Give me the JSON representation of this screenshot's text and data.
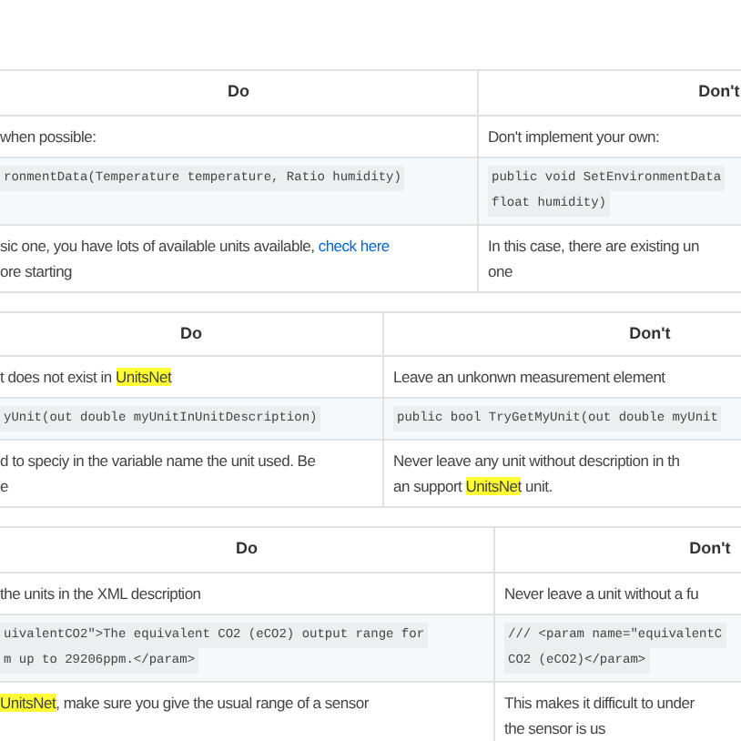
{
  "tables": [
    {
      "header": [
        "Do",
        "Don't"
      ],
      "rows": [
        {
          "cells": [
            {
              "kind": "text",
              "lines": [
                [
                  {
                    "text": "when possible:",
                    "kind": "plain"
                  }
                ]
              ]
            },
            {
              "kind": "text",
              "lines": [
                [
                  {
                    "text": "Don't implement your own:",
                    "kind": "plain"
                  }
                ]
              ]
            }
          ]
        },
        {
          "cells": [
            {
              "kind": "code",
              "lines": [
                [
                  {
                    "text": "ronmentData(Temperature temperature, Ratio humidity)",
                    "kind": "plain"
                  }
                ]
              ]
            },
            {
              "kind": "code",
              "lines": [
                [
                  {
                    "text": "public void SetEnvironmentData",
                    "kind": "plain"
                  }
                ],
                [
                  {
                    "text": "float humidity)",
                    "kind": "plain"
                  }
                ]
              ]
            }
          ]
        },
        {
          "cells": [
            {
              "kind": "text",
              "lines": [
                [
                  {
                    "text": "sic one, you have lots of available units available, ",
                    "kind": "plain"
                  },
                  {
                    "text": "check here",
                    "kind": "link"
                  }
                ],
                [
                  {
                    "text": "ore starting",
                    "kind": "plain"
                  }
                ]
              ]
            },
            {
              "kind": "text",
              "lines": [
                [
                  {
                    "text": "In this case, there are existing un",
                    "kind": "plain"
                  }
                ],
                [
                  {
                    "text": "one",
                    "kind": "plain"
                  }
                ]
              ]
            }
          ]
        }
      ]
    },
    {
      "header": [
        "Do",
        "Don't"
      ],
      "rows": [
        {
          "cells": [
            {
              "kind": "text",
              "lines": [
                [
                  {
                    "text": "t does not exist in ",
                    "kind": "plain"
                  },
                  {
                    "text": "UnitsNet",
                    "kind": "highlight"
                  }
                ]
              ]
            },
            {
              "kind": "text",
              "lines": [
                [
                  {
                    "text": "Leave an unkonwn measurement element",
                    "kind": "plain"
                  }
                ]
              ]
            }
          ]
        },
        {
          "cells": [
            {
              "kind": "code",
              "lines": [
                [
                  {
                    "text": "yUnit(out double myUnitInUnitDescription)",
                    "kind": "plain"
                  }
                ]
              ]
            },
            {
              "kind": "code",
              "lines": [
                [
                  {
                    "text": "public bool TryGetMyUnit(out double myUnit",
                    "kind": "plain"
                  }
                ]
              ]
            }
          ]
        },
        {
          "cells": [
            {
              "kind": "text",
              "lines": [
                [
                  {
                    "text": "d to speciy in the variable name the unit used. Be",
                    "kind": "plain"
                  }
                ],
                [
                  {
                    "text": "e",
                    "kind": "plain"
                  }
                ]
              ]
            },
            {
              "kind": "text",
              "lines": [
                [
                  {
                    "text": "Never leave any unit without description in th",
                    "kind": "plain"
                  }
                ],
                [
                  {
                    "text": "an support ",
                    "kind": "plain"
                  },
                  {
                    "text": "UnitsNet",
                    "kind": "highlight"
                  },
                  {
                    "text": " unit.",
                    "kind": "plain"
                  }
                ]
              ]
            }
          ]
        }
      ]
    },
    {
      "header": [
        "Do",
        "Don't"
      ],
      "rows": [
        {
          "cells": [
            {
              "kind": "text",
              "lines": [
                [
                  {
                    "text": "the units in the XML description",
                    "kind": "plain"
                  }
                ]
              ]
            },
            {
              "kind": "text",
              "lines": [
                [
                  {
                    "text": "Never leave a unit without a fu",
                    "kind": "plain"
                  }
                ]
              ]
            }
          ]
        },
        {
          "cells": [
            {
              "kind": "code",
              "lines": [
                [
                  {
                    "text": "uivalentCO2\">The equivalent CO2 (eCO2) output range for",
                    "kind": "plain"
                  }
                ],
                [
                  {
                    "text": "m up to 29206ppm.</param>",
                    "kind": "plain"
                  }
                ]
              ]
            },
            {
              "kind": "code",
              "lines": [
                [
                  {
                    "text": "/// <param name=\"equivalentC",
                    "kind": "plain"
                  }
                ],
                [
                  {
                    "text": "CO2 (eCO2)</param>",
                    "kind": "plain"
                  }
                ]
              ]
            }
          ]
        },
        {
          "cells": [
            {
              "kind": "text",
              "lines": [
                [
                  {
                    "text": "UnitsNet",
                    "kind": "highlight"
                  },
                  {
                    "text": ", make sure you give the usual range of a sensor",
                    "kind": "plain"
                  }
                ]
              ]
            },
            {
              "kind": "text",
              "lines": [
                [
                  {
                    "text": "This makes it difficult to under",
                    "kind": "plain"
                  }
                ],
                [
                  {
                    "text": "the sensor is us",
                    "kind": "plain"
                  }
                ]
              ]
            }
          ]
        }
      ]
    }
  ]
}
